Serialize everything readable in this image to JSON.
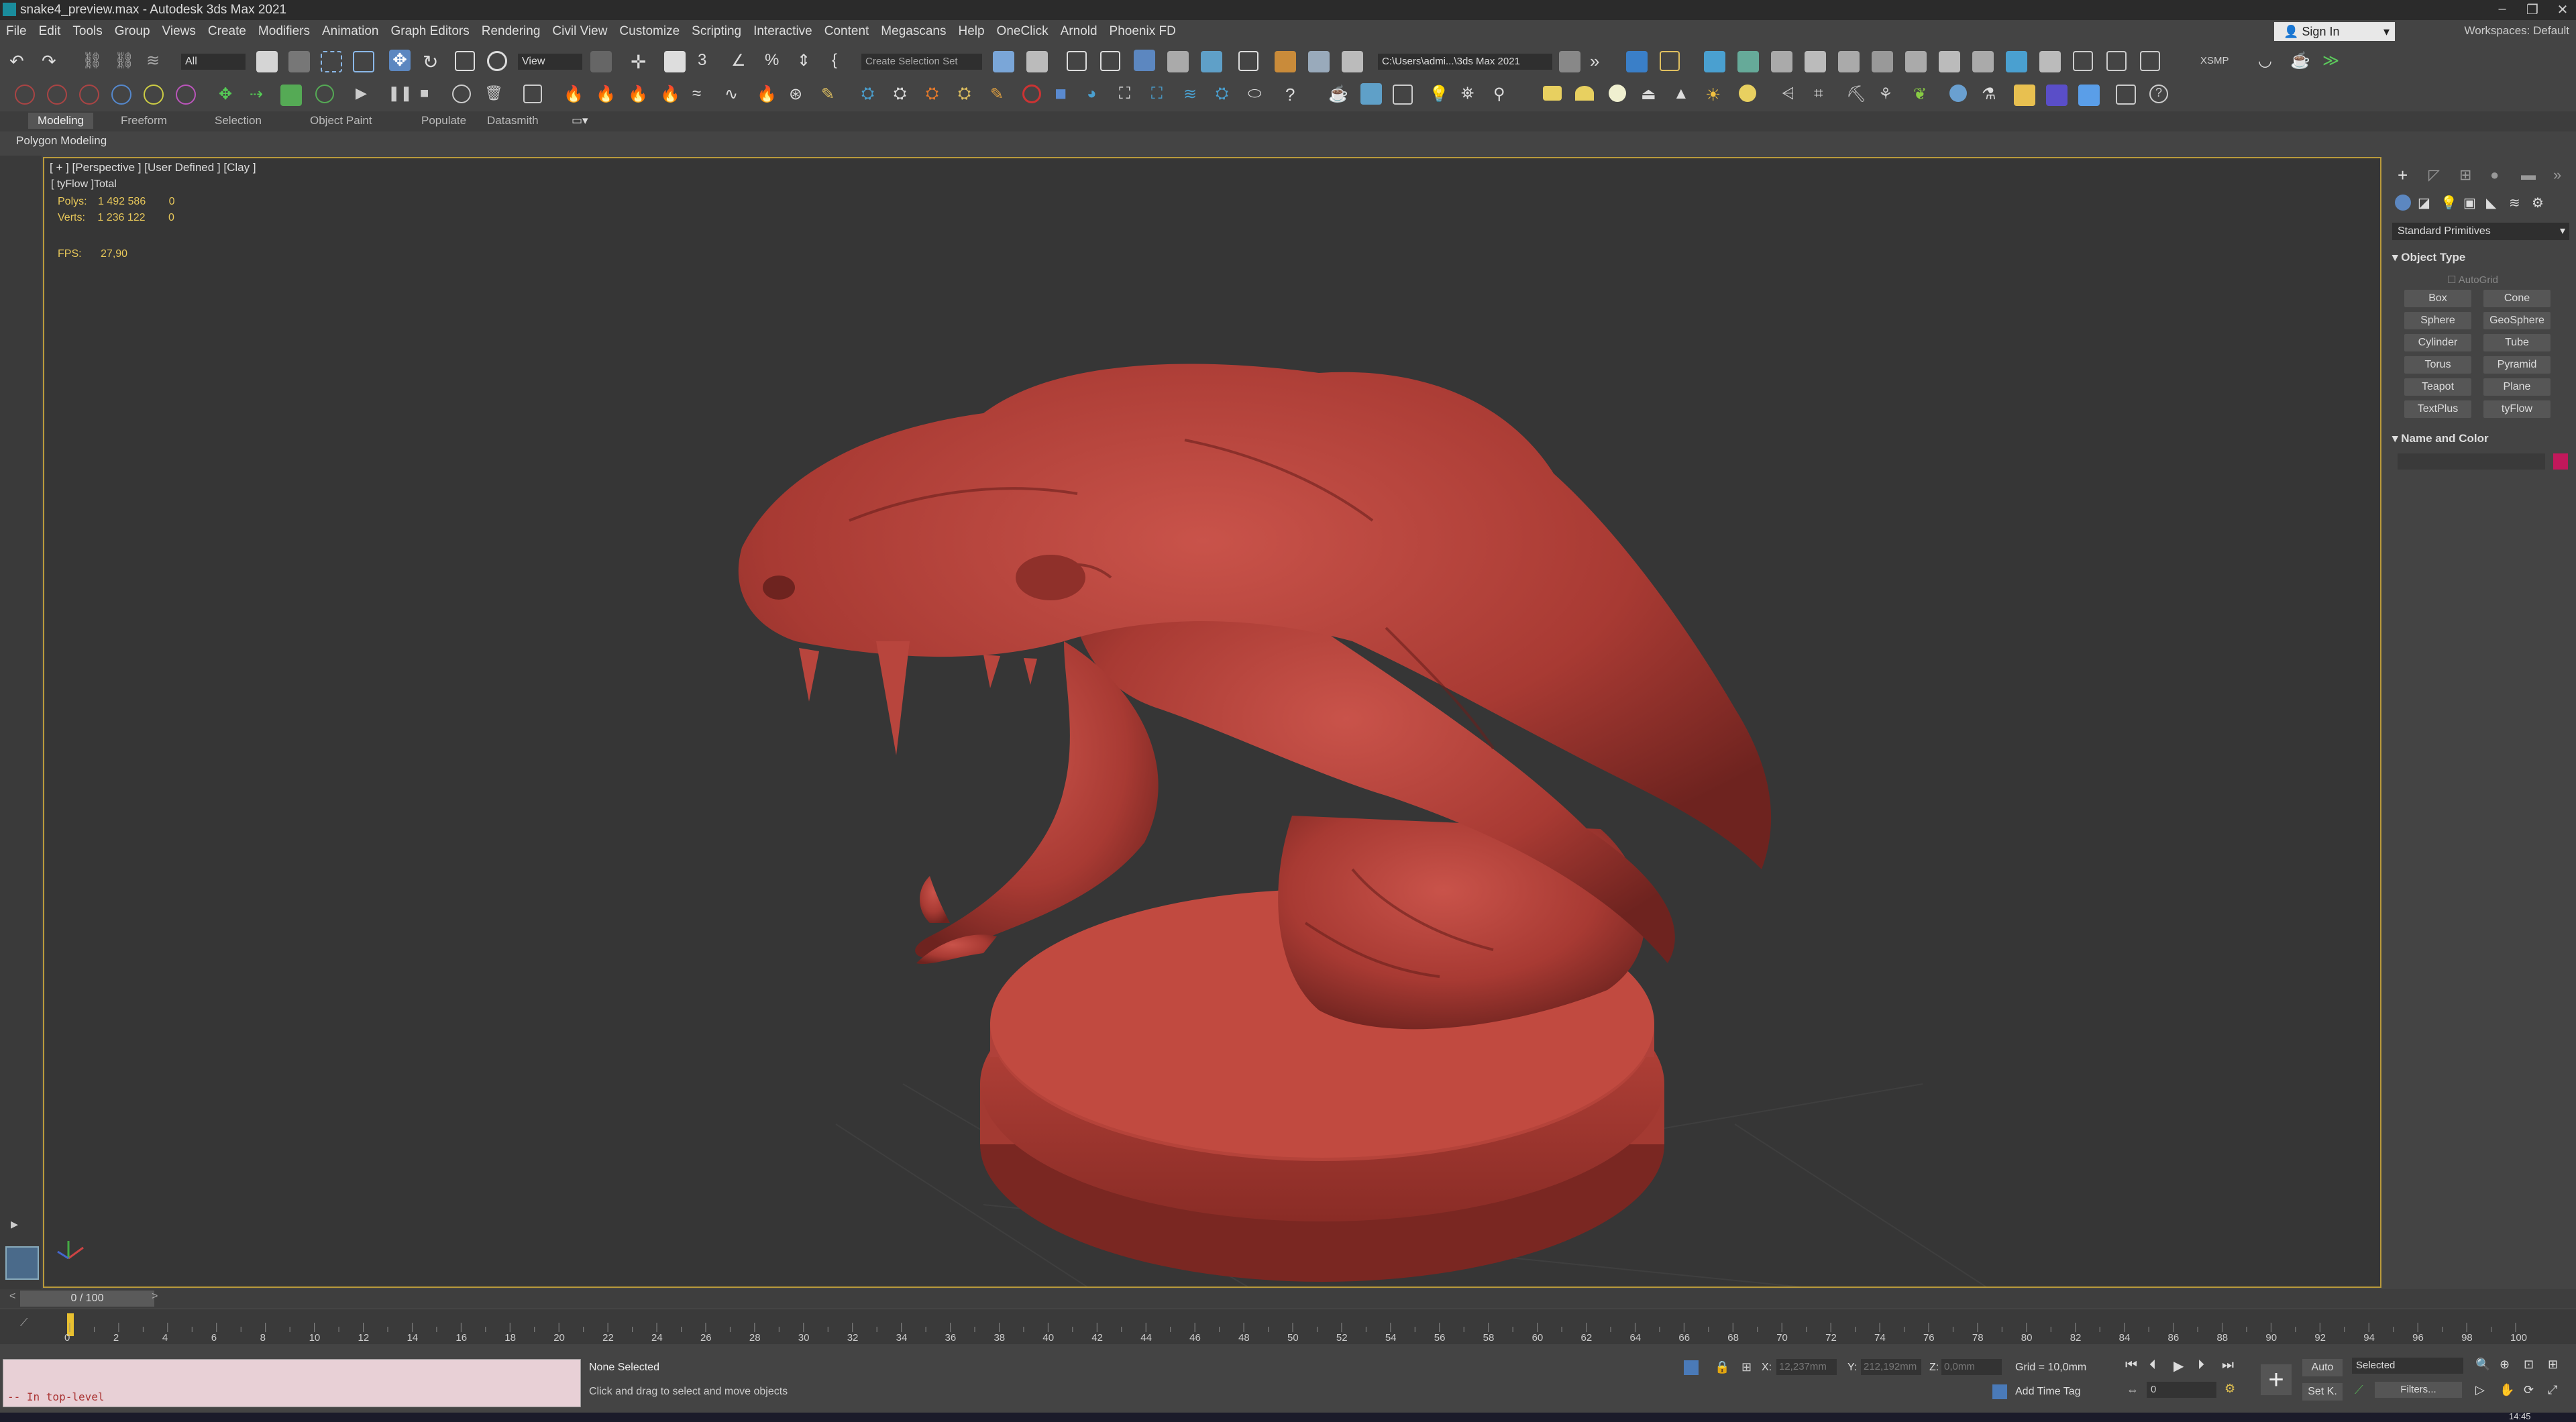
{
  "window": {
    "title": "snake4_preview.max - Autodesk 3ds Max 2021",
    "controls": [
      "–",
      "❐",
      "✕"
    ]
  },
  "menu": [
    "File",
    "Edit",
    "Tools",
    "Group",
    "Views",
    "Create",
    "Modifiers",
    "Animation",
    "Graph Editors",
    "Rendering",
    "Civil View",
    "Customize",
    "Scripting",
    "Interactive",
    "Content",
    "Megascans",
    "Help",
    "OneClick",
    "Arnold",
    "Phoenix FD"
  ],
  "signin": "Sign In",
  "workspace": "Workspaces: Default",
  "toolbar": {
    "selection_filter": "All",
    "ref_coord": "View",
    "named_selection": "Create Selection Set",
    "project_path": "C:\\Users\\admi...\\3ds Max 2021",
    "xsmp": "XSMP"
  },
  "ribbon": {
    "tabs": [
      "Modeling",
      "Freeform",
      "Selection",
      "Object Paint",
      "Populate",
      "Datasmith"
    ],
    "active_tab": "Modeling",
    "panel": "Polygon Modeling"
  },
  "viewport": {
    "label": "[ + ] [Perspective ] [User Defined ] [Clay ]",
    "stats_header": "[ tyFlow ]Total",
    "polys_label": "Polys:",
    "polys_total": "1 492 586",
    "polys_tyflow": "0",
    "verts_label": "Verts:",
    "verts_total": "1 236 122",
    "verts_tyflow": "0",
    "fps_label": "FPS:",
    "fps_value": "27,90"
  },
  "command_panel": {
    "category": "Standard Primitives",
    "object_type_title": "Object Type",
    "autogrid": "AutoGrid",
    "buttons": [
      "Box",
      "Cone",
      "Sphere",
      "GeoSphere",
      "Cylinder",
      "Tube",
      "Torus",
      "Pyramid",
      "Teapot",
      "Plane",
      "TextPlus",
      "tyFlow"
    ],
    "name_color_title": "Name and Color",
    "object_color": "#c2185b"
  },
  "timeline": {
    "slider": "0 / 100",
    "ticks": [
      "0",
      "2",
      "4",
      "6",
      "8",
      "10",
      "12",
      "14",
      "16",
      "18",
      "20",
      "22",
      "24",
      "26",
      "28",
      "30",
      "32",
      "34",
      "36",
      "38",
      "40",
      "42",
      "44",
      "46",
      "48",
      "50",
      "52",
      "54",
      "56",
      "58",
      "60",
      "62",
      "64",
      "66",
      "68",
      "70",
      "72",
      "74",
      "76",
      "78",
      "80",
      "82",
      "84",
      "86",
      "88",
      "90",
      "92",
      "94",
      "96",
      "98",
      "100"
    ]
  },
  "status": {
    "maxscript": "-- In top-level",
    "selection": "None Selected",
    "prompt": "Click and drag to select and move objects",
    "x_label": "X:",
    "x_value": "12,237mm",
    "y_label": "Y:",
    "y_value": "212,192mm",
    "z_label": "Z:",
    "z_value": "0,0mm",
    "grid": "Grid = 10,0mm",
    "add_time_tag": "Add Time Tag",
    "auto": "Auto",
    "set_key": "Set K.",
    "selected": "Selected",
    "filters": "Filters...",
    "frame": "0",
    "clock": "14:45"
  },
  "colors": {
    "clay": "#b8453d",
    "viewport_border": "#b99a3b",
    "stats": "#e8c85a"
  }
}
